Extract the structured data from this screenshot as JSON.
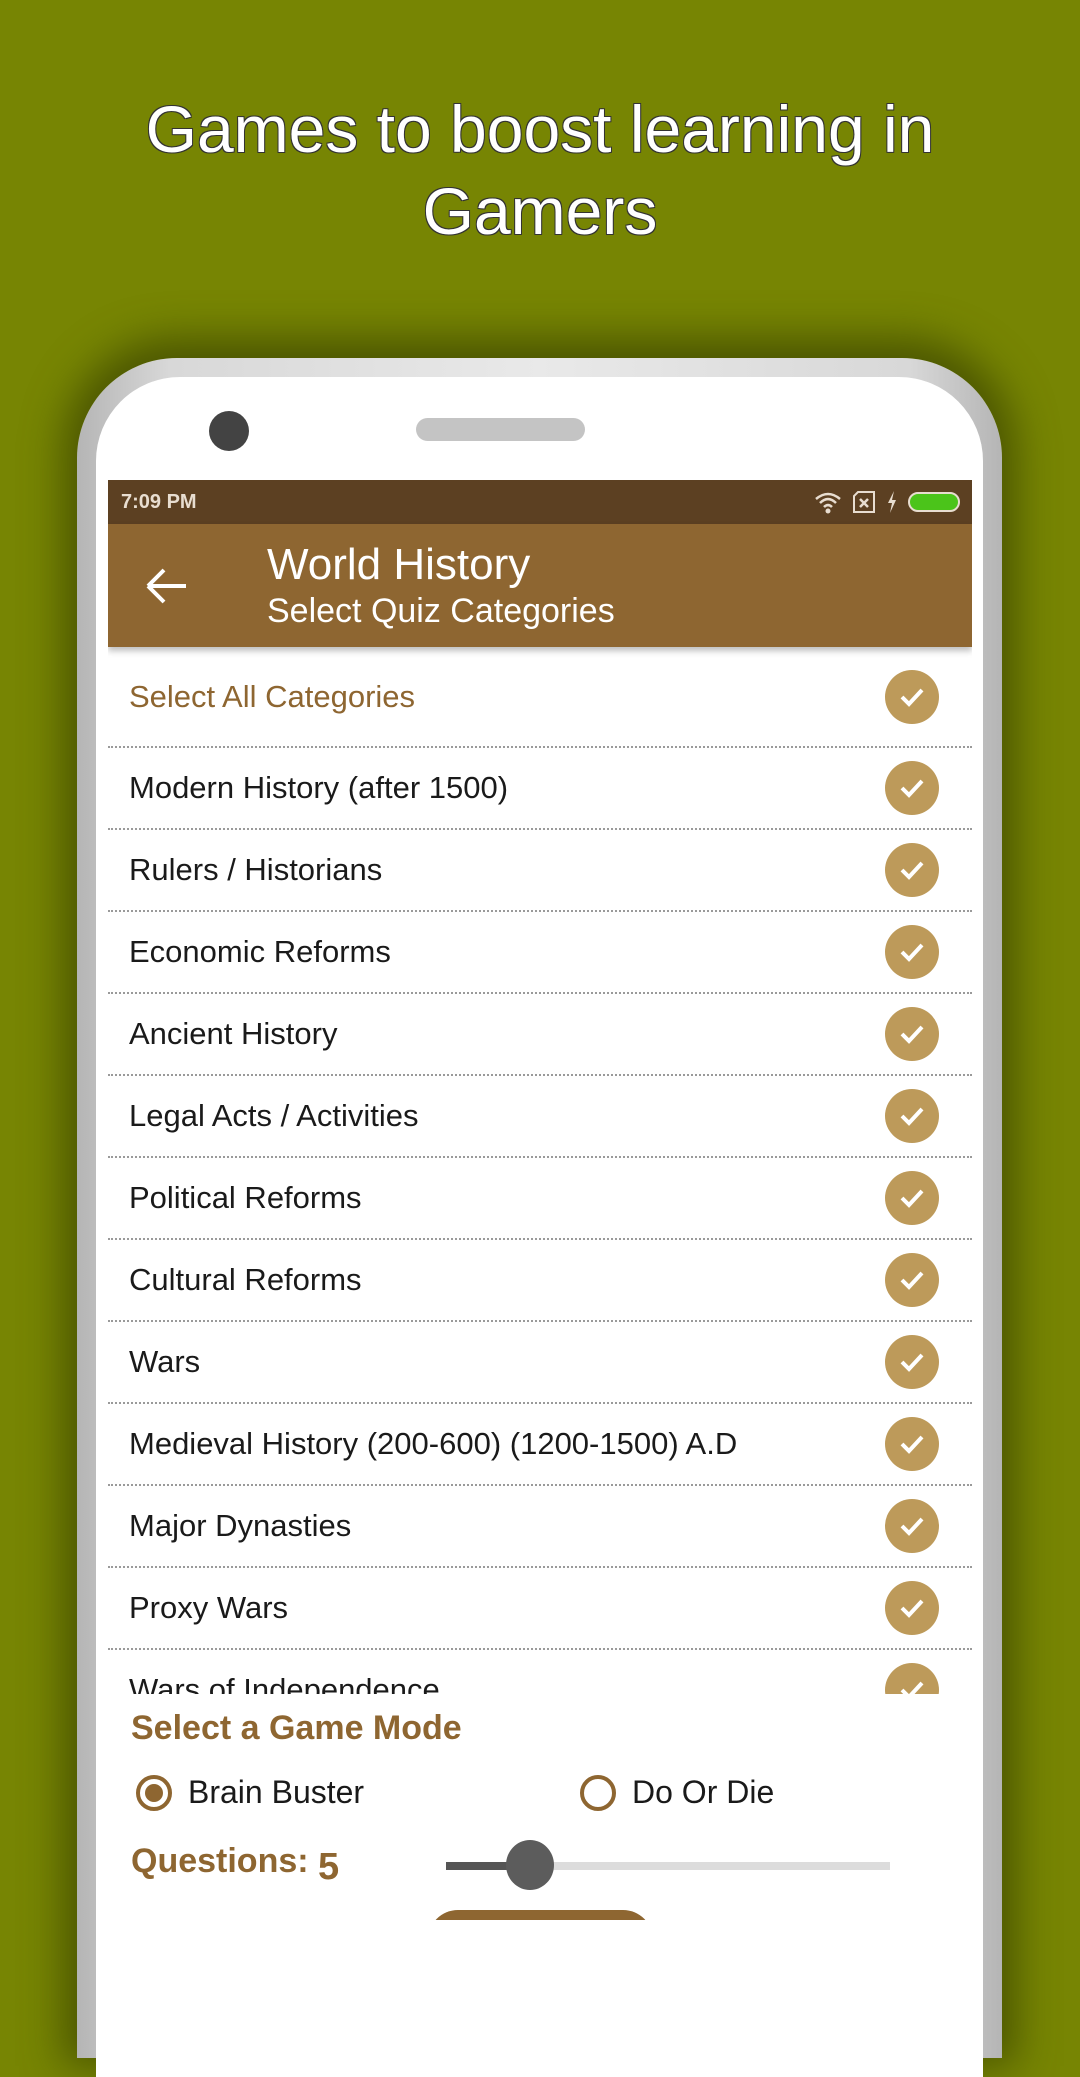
{
  "headline": {
    "line1": "Games to boost learning in",
    "line2": "Gamers"
  },
  "status_bar": {
    "time": "7:09 PM",
    "icons": [
      "wifi-icon",
      "no-sim-icon",
      "charging-icon",
      "battery-icon"
    ]
  },
  "app_bar": {
    "title": "World History",
    "subtitle": "Select Quiz Categories",
    "back_icon": "arrow-left-icon"
  },
  "categories": {
    "select_all": {
      "label": "Select All Categories",
      "checked": true
    },
    "items": [
      {
        "label": "Modern History (after 1500)",
        "checked": true
      },
      {
        "label": "Rulers / Historians",
        "checked": true
      },
      {
        "label": "Economic Reforms",
        "checked": true
      },
      {
        "label": "Ancient History",
        "checked": true
      },
      {
        "label": "Legal Acts / Activities",
        "checked": true
      },
      {
        "label": "Political Reforms",
        "checked": true
      },
      {
        "label": "Cultural Reforms",
        "checked": true
      },
      {
        "label": "Wars",
        "checked": true
      },
      {
        "label": "Medieval History (200-600) (1200-1500) A.D",
        "checked": true
      },
      {
        "label": "Major Dynasties",
        "checked": true
      },
      {
        "label": "Proxy Wars",
        "checked": true
      },
      {
        "label": "Wars of Independence",
        "checked": true
      }
    ]
  },
  "game_mode": {
    "title": "Select a Game Mode",
    "options": [
      {
        "label": "Brain Buster",
        "selected": true
      },
      {
        "label": "Do Or Die",
        "selected": false
      }
    ]
  },
  "questions": {
    "label": "Questions:",
    "value": "5",
    "slider_fraction": 0.19
  },
  "colors": {
    "background": "#778503",
    "status_bar": "#5c4022",
    "app_bar": "#8e6631",
    "check": "#bd9a5a",
    "accent_text": "#8e6631"
  }
}
